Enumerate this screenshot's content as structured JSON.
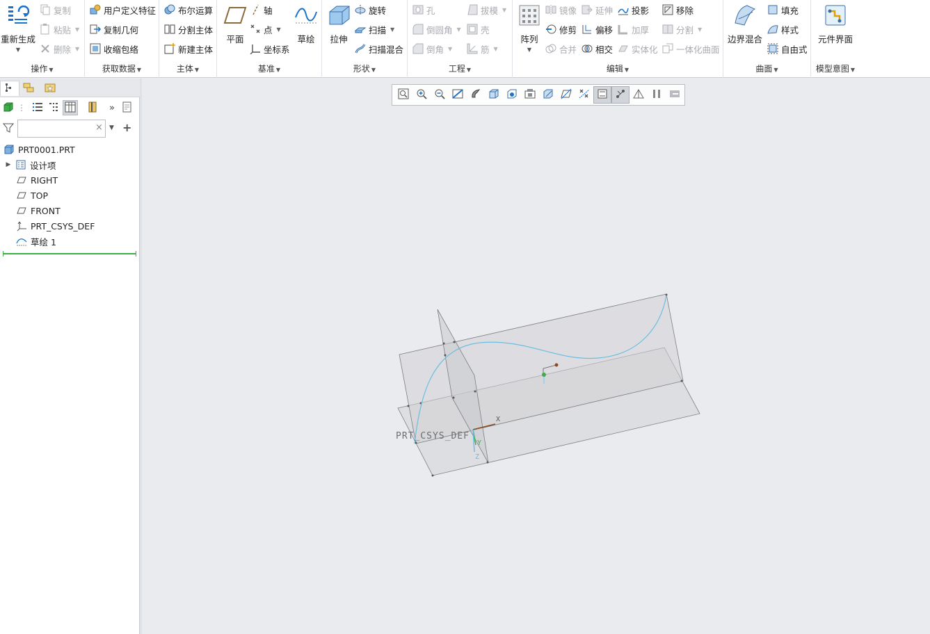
{
  "ribbon": {
    "operations": {
      "label": "操作",
      "regenerate": "重新生成",
      "copy": "复制",
      "paste": "粘贴",
      "delete": "删除"
    },
    "get_data": {
      "label": "获取数据",
      "udf": "用户定义特征",
      "copy_geometry": "复制几何",
      "shrinkwrap": "收缩包络"
    },
    "body": {
      "label": "主体",
      "boolean": "布尔运算",
      "split_body": "分割主体",
      "new_body": "新建主体"
    },
    "datum": {
      "label": "基准",
      "plane": "平面",
      "axis": "轴",
      "point": "点",
      "csys": "坐标系",
      "sketch": "草绘"
    },
    "shapes": {
      "label": "形状",
      "extrude": "拉伸",
      "revolve": "旋转",
      "sweep": "扫描",
      "swept_blend": "扫描混合"
    },
    "engineering": {
      "label": "工程",
      "hole": "孔",
      "round": "倒圆角",
      "chamfer": "倒角",
      "draft": "拔模",
      "shell": "壳",
      "rib": "筋"
    },
    "editing": {
      "label": "编辑",
      "pattern": "阵列",
      "mirror": "镜像",
      "extend": "延伸",
      "project": "投影",
      "remove": "移除",
      "trim": "修剪",
      "offset": "偏移",
      "thicken": "加厚",
      "split": "分割",
      "merge": "合并",
      "intersect": "相交",
      "solidify": "实体化",
      "unify_surface": "一体化曲面"
    },
    "surfaces": {
      "label": "曲面",
      "boundary_blend": "边界混合",
      "fill": "填充",
      "style": "样式",
      "freestyle": "自由式"
    },
    "model_intent": {
      "label": "模型意图",
      "component_interface": "元件界面"
    }
  },
  "left_panel": {
    "search_value": "",
    "tree": [
      {
        "label": "PRT0001.PRT",
        "icon": "part-icon"
      },
      {
        "label": "设计项",
        "icon": "design-items-icon",
        "expandable": true
      },
      {
        "label": "RIGHT",
        "icon": "datum-plane-icon"
      },
      {
        "label": "TOP",
        "icon": "datum-plane-icon"
      },
      {
        "label": "FRONT",
        "icon": "datum-plane-icon"
      },
      {
        "label": "PRT_CSYS_DEF",
        "icon": "csys-icon"
      },
      {
        "label": "草绘 1",
        "icon": "sketch-icon"
      }
    ]
  },
  "viewport": {
    "csys_label": "PRT_CSYS_DEF",
    "axis_x": "X",
    "axis_y": "Y",
    "axis_z": "Z"
  },
  "colors": {
    "accent": "#1a73c8",
    "disabled": "#a9abb0",
    "curve": "#6bbde0",
    "insert_line": "#3cb043"
  }
}
